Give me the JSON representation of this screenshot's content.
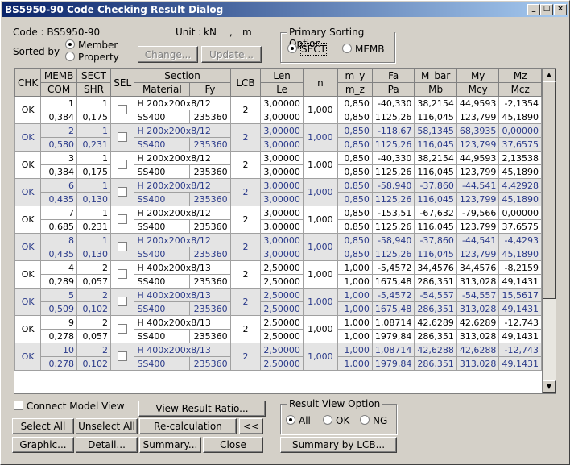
{
  "window": {
    "title": "BS5950-90 Code Checking Result Dialog",
    "btn_min": "_",
    "btn_max": "□",
    "btn_close": "×"
  },
  "code": {
    "label": "Code : BS5950-90",
    "unit_label": "Unit :",
    "unit_force": "kN",
    "unit_sep": ",",
    "unit_len": "m"
  },
  "sort": {
    "label": "Sorted by",
    "opt1": "Member",
    "opt2": "Property",
    "change": "Change...",
    "update": "Update..."
  },
  "primary": {
    "title": "Primary Sorting Option",
    "opt1": "SECT",
    "opt2": "MEMB"
  },
  "headers": {
    "chk": "CHK",
    "memb": "MEMB",
    "com": "COM",
    "sect": "SECT",
    "shr": "SHR",
    "sel": "SEL",
    "section": "Section",
    "material": "Material",
    "fy": "Fy",
    "lcb": "LCB",
    "len": "Len",
    "le": "Le",
    "n": "n",
    "my": "m_y",
    "mz": "m_z",
    "fa": "Fa",
    "pa": "Pa",
    "mbar": "M_bar",
    "mb": "Mb",
    "myv": "My",
    "mcy": "Mcy",
    "mzv": "Mz",
    "mcz": "Mcz"
  },
  "rows": [
    {
      "chk": "OK",
      "memb": "1",
      "com": "0,384",
      "sect": "1",
      "shr": "0,175",
      "sec": "H 200x200x8/12",
      "mat": "SS400",
      "fy": "235360",
      "lcb": "2",
      "len": "3,00000",
      "le": "3,00000",
      "n": "1,000",
      "my": "0,850",
      "mz": "0,850",
      "fa": "-40,330",
      "pa": "1125,26",
      "mbar": "38,2154",
      "mb": "116,045",
      "myv": "44,9593",
      "mcy": "123,799",
      "mzv": "-2,1354",
      "mcz": "45,1890"
    },
    {
      "chk": "OK",
      "memb": "2",
      "com": "0,580",
      "sect": "1",
      "shr": "0,231",
      "sec": "H 200x200x8/12",
      "mat": "SS400",
      "fy": "235360",
      "lcb": "2",
      "len": "3,00000",
      "le": "3,00000",
      "n": "1,000",
      "my": "0,850",
      "mz": "0,850",
      "fa": "-118,67",
      "pa": "1125,26",
      "mbar": "58,1345",
      "mb": "116,045",
      "myv": "68,3935",
      "mcy": "123,799",
      "mzv": "0,00000",
      "mcz": "37,6575"
    },
    {
      "chk": "OK",
      "memb": "3",
      "com": "0,384",
      "sect": "1",
      "shr": "0,175",
      "sec": "H 200x200x8/12",
      "mat": "SS400",
      "fy": "235360",
      "lcb": "2",
      "len": "3,00000",
      "le": "3,00000",
      "n": "1,000",
      "my": "0,850",
      "mz": "0,850",
      "fa": "-40,330",
      "pa": "1125,26",
      "mbar": "38,2154",
      "mb": "116,045",
      "myv": "44,9593",
      "mcy": "123,799",
      "mzv": "2,13538",
      "mcz": "45,1890"
    },
    {
      "chk": "OK",
      "memb": "6",
      "com": "0,435",
      "sect": "1",
      "shr": "0,130",
      "sec": "H 200x200x8/12",
      "mat": "SS400",
      "fy": "235360",
      "lcb": "2",
      "len": "3,00000",
      "le": "3,00000",
      "n": "1,000",
      "my": "0,850",
      "mz": "0,850",
      "fa": "-58,940",
      "pa": "1125,26",
      "mbar": "-37,860",
      "mb": "116,045",
      "myv": "-44,541",
      "mcy": "123,799",
      "mzv": "4,42928",
      "mcz": "45,1890"
    },
    {
      "chk": "OK",
      "memb": "7",
      "com": "0,685",
      "sect": "1",
      "shr": "0,231",
      "sec": "H 200x200x8/12",
      "mat": "SS400",
      "fy": "235360",
      "lcb": "2",
      "len": "3,00000",
      "le": "3,00000",
      "n": "1,000",
      "my": "0,850",
      "mz": "0,850",
      "fa": "-153,51",
      "pa": "1125,26",
      "mbar": "-67,632",
      "mb": "116,045",
      "myv": "-79,566",
      "mcy": "123,799",
      "mzv": "0,00000",
      "mcz": "37,6575"
    },
    {
      "chk": "OK",
      "memb": "8",
      "com": "0,435",
      "sect": "1",
      "shr": "0,130",
      "sec": "H 200x200x8/12",
      "mat": "SS400",
      "fy": "235360",
      "lcb": "2",
      "len": "3,00000",
      "le": "3,00000",
      "n": "1,000",
      "my": "0,850",
      "mz": "0,850",
      "fa": "-58,940",
      "pa": "1125,26",
      "mbar": "-37,860",
      "mb": "116,045",
      "myv": "-44,541",
      "mcy": "123,799",
      "mzv": "-4,4293",
      "mcz": "45,1890"
    },
    {
      "chk": "OK",
      "memb": "4",
      "com": "0,289",
      "sect": "2",
      "shr": "0,057",
      "sec": "H 400x200x8/13",
      "mat": "SS400",
      "fy": "235360",
      "lcb": "2",
      "len": "2,50000",
      "le": "2,50000",
      "n": "1,000",
      "my": "1,000",
      "mz": "1,000",
      "fa": "-5,4572",
      "pa": "1675,48",
      "mbar": "34,4576",
      "mb": "286,351",
      "myv": "34,4576",
      "mcy": "313,028",
      "mzv": "-8,2159",
      "mcz": "49,1431"
    },
    {
      "chk": "OK",
      "memb": "5",
      "com": "0,509",
      "sect": "2",
      "shr": "0,102",
      "sec": "H 400x200x8/13",
      "mat": "SS400",
      "fy": "235360",
      "lcb": "2",
      "len": "2,50000",
      "le": "2,50000",
      "n": "1,000",
      "my": "1,000",
      "mz": "1,000",
      "fa": "-5,4572",
      "pa": "1675,48",
      "mbar": "-54,557",
      "mb": "286,351",
      "myv": "-54,557",
      "mcy": "313,028",
      "mzv": "15,5617",
      "mcz": "49,1431"
    },
    {
      "chk": "OK",
      "memb": "9",
      "com": "0,278",
      "sect": "2",
      "shr": "0,057",
      "sec": "H 400x200x8/13",
      "mat": "SS400",
      "fy": "235360",
      "lcb": "2",
      "len": "2,50000",
      "le": "2,50000",
      "n": "1,000",
      "my": "1,000",
      "mz": "1,000",
      "fa": "1,08714",
      "pa": "1979,84",
      "mbar": "42,6289",
      "mb": "286,351",
      "myv": "42,6289",
      "mcy": "313,028",
      "mzv": "-12,743",
      "mcz": "49,1431"
    },
    {
      "chk": "OK",
      "memb": "10",
      "com": "0,278",
      "sect": "2",
      "shr": "0,102",
      "sec": "H 400x200x8/13",
      "mat": "SS400",
      "fy": "235360",
      "lcb": "2",
      "len": "2,50000",
      "le": "2,50000",
      "n": "1,000",
      "my": "1,000",
      "mz": "1,000",
      "fa": "1,08714",
      "pa": "1979,84",
      "mbar": "42,6288",
      "mb": "286,351",
      "myv": "42,6288",
      "mcy": "313,028",
      "mzv": "-12,743",
      "mcz": "49,1431"
    }
  ],
  "bottom": {
    "connect": "Connect Model View",
    "view_ratio": "View Result Ratio...",
    "select_all": "Select All",
    "unselect_all": "Unselect All",
    "recalc": "Re-calculation",
    "collapse": "<<",
    "graphic": "Graphic...",
    "detail": "Detail...",
    "summary": "Summary...",
    "close": "Close",
    "summary_lcb": "Summary by LCB..."
  },
  "result_view": {
    "title": "Result View Option",
    "all": "All",
    "ok": "OK",
    "ng": "NG"
  }
}
